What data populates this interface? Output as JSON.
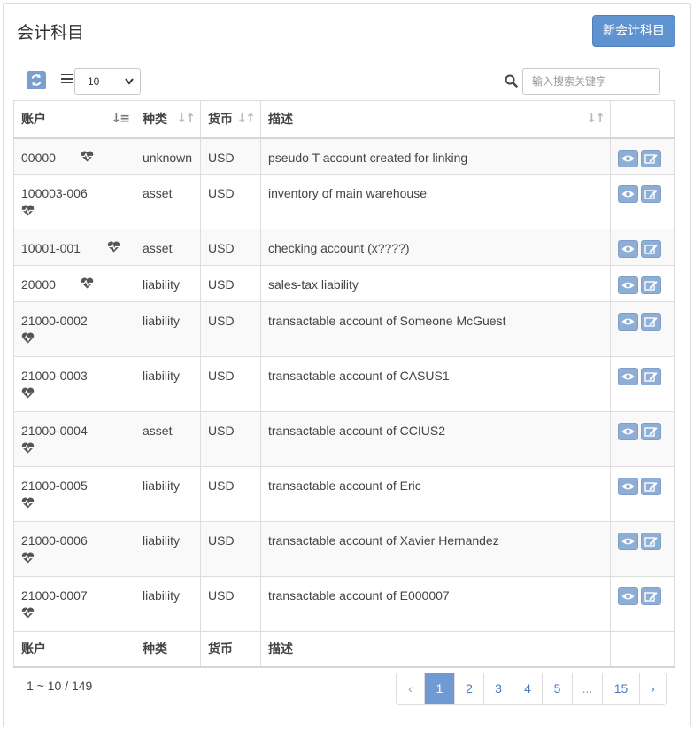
{
  "header": {
    "title": "会计科目",
    "new_button_label": "新会计科目"
  },
  "toolbar": {
    "page_size": "10",
    "search_placeholder": "输入搜索关键字",
    "icons": {
      "refresh": "refresh-icon",
      "columns": "menu-icon",
      "search": "search-icon"
    }
  },
  "table": {
    "columns": [
      "账户",
      "种类",
      "货币",
      "描述"
    ],
    "rows": [
      {
        "account": "00000",
        "kind": "unknown",
        "currency": "USD",
        "description": "pseudo T account created for linking"
      },
      {
        "account": "100003-006",
        "kind": "asset",
        "currency": "USD",
        "description": "inventory of main warehouse"
      },
      {
        "account": "10001-001",
        "kind": "asset",
        "currency": "USD",
        "description": "checking account (x????)"
      },
      {
        "account": "20000",
        "kind": "liability",
        "currency": "USD",
        "description": "sales-tax liability"
      },
      {
        "account": "21000-0002",
        "kind": "liability",
        "currency": "USD",
        "description": "transactable account of Someone McGuest"
      },
      {
        "account": "21000-0003",
        "kind": "liability",
        "currency": "USD",
        "description": "transactable account of CASUS1"
      },
      {
        "account": "21000-0004",
        "kind": "asset",
        "currency": "USD",
        "description": "transactable account of CCIUS2"
      },
      {
        "account": "21000-0005",
        "kind": "liability",
        "currency": "USD",
        "description": "transactable account of Eric"
      },
      {
        "account": "21000-0006",
        "kind": "liability",
        "currency": "USD",
        "description": "transactable account of Xavier Hernandez"
      },
      {
        "account": "21000-0007",
        "kind": "liability",
        "currency": "USD",
        "description": "transactable account of E000007"
      }
    ],
    "footer": [
      "账户",
      "种类",
      "货币",
      "描述"
    ]
  },
  "pagination": {
    "range": "1 ~ 10 / 149",
    "prev": "‹",
    "pages": [
      "1",
      "2",
      "3",
      "4",
      "5",
      "...",
      "15"
    ],
    "current": "1",
    "next": "›"
  },
  "colors": {
    "primary": "#5f93d0",
    "active_page": "#6f9ad4",
    "op_button": "#8eaed5"
  }
}
